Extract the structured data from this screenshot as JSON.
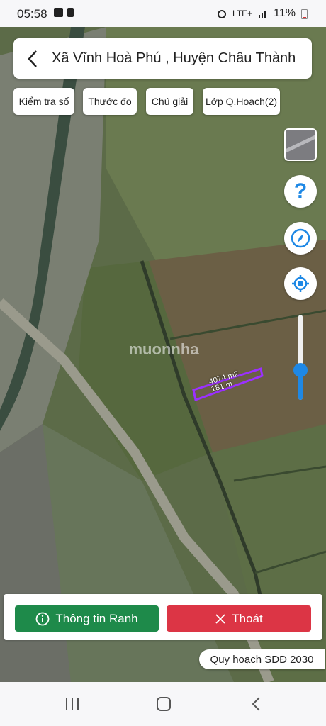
{
  "status_bar": {
    "time": "05:58",
    "network": "LTE+",
    "battery": "11%"
  },
  "header": {
    "title": "Xã Vĩnh Hoà Phú , Huyện Châu Thành"
  },
  "chips": [
    {
      "label": "Kiểm tra số"
    },
    {
      "label": "Thước đo"
    },
    {
      "label": "Chú giải"
    },
    {
      "label": "Lớp Q.Hoạch(2)"
    }
  ],
  "side_controls": {
    "help_label": "?"
  },
  "measure": {
    "area": "4074 m2",
    "length": "181 m"
  },
  "watermark": "muonnha",
  "actions": {
    "info_label": "Thông tin Ranh",
    "exit_label": "Thoát"
  },
  "plan_badge": "Quy hoạch SDĐ 2030",
  "zoom_level": 0.35,
  "colors": {
    "green": "#1e8a4a",
    "red": "#dc3545",
    "accent": "#1e88e5"
  }
}
